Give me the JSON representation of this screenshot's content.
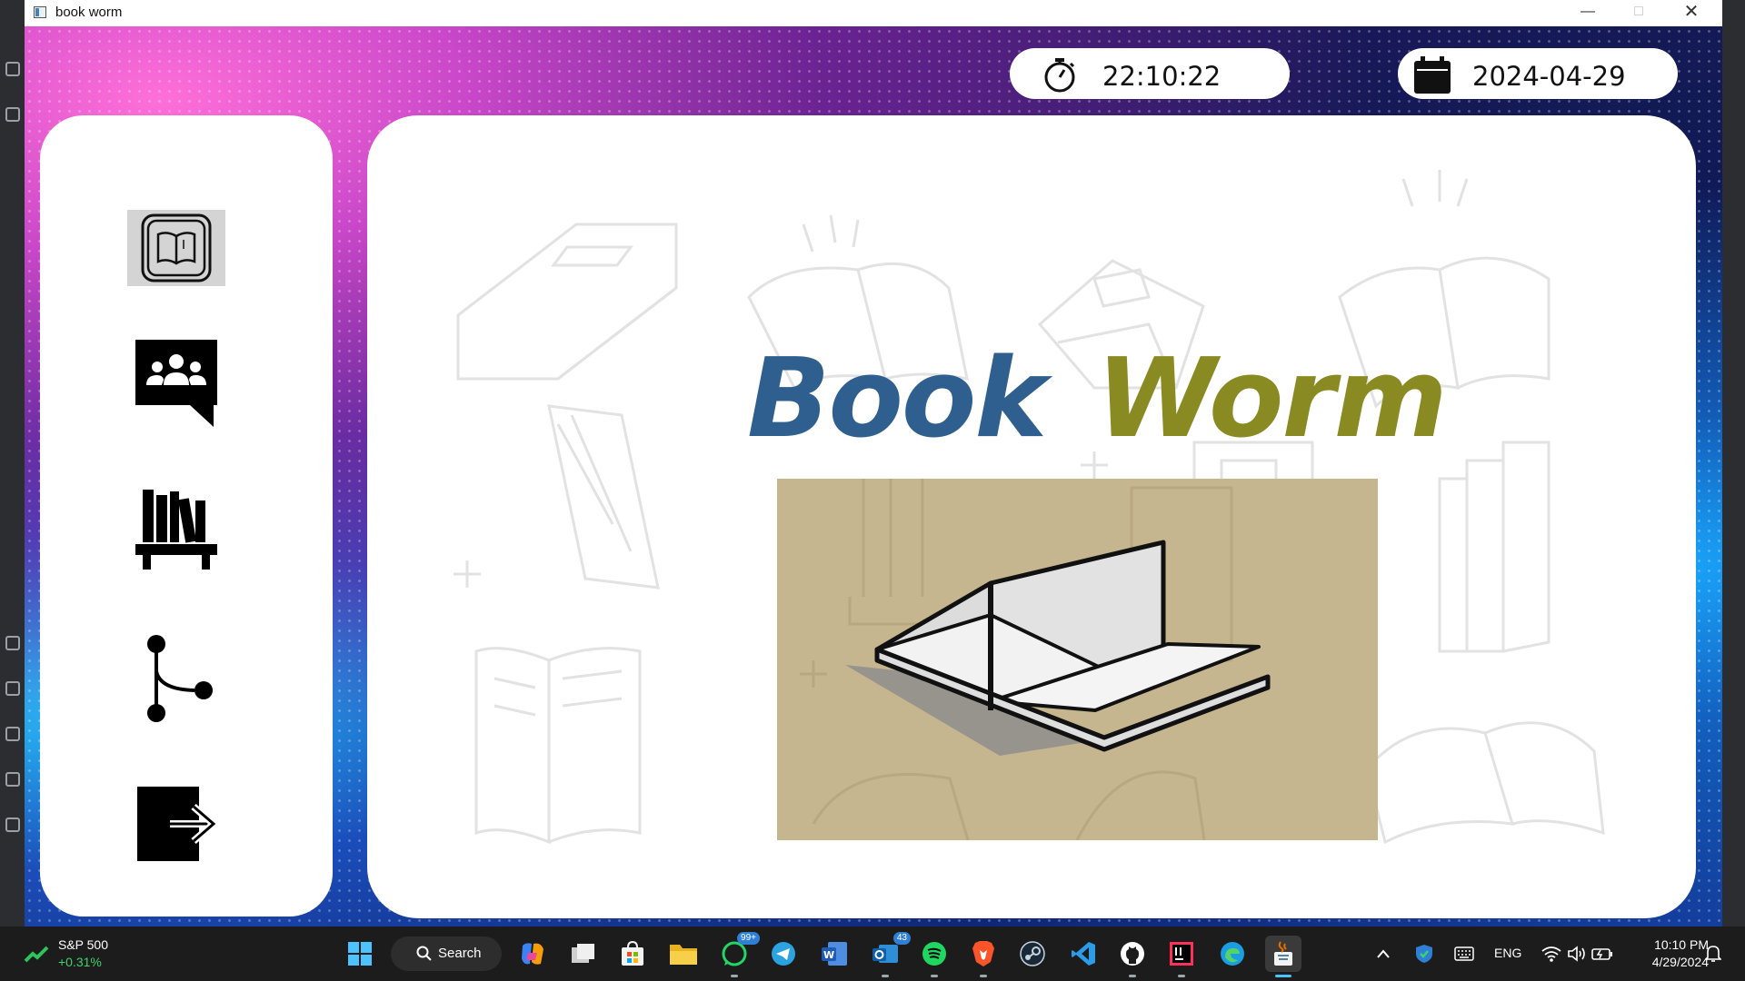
{
  "window": {
    "title": "book worm"
  },
  "clock": {
    "time": "22:10:22"
  },
  "calendar": {
    "date": "2024-04-29"
  },
  "sidebar": {
    "items": [
      {
        "name": "books",
        "icon": "open-book-icon",
        "active": true
      },
      {
        "name": "community",
        "icon": "group-chat-icon",
        "active": false
      },
      {
        "name": "library",
        "icon": "bookshelf-icon",
        "active": false
      },
      {
        "name": "branches",
        "icon": "branch-icon",
        "active": false
      },
      {
        "name": "logout",
        "icon": "logout-icon",
        "active": false
      }
    ]
  },
  "main": {
    "title_word1": "Book",
    "title_word2": "Worm"
  },
  "colors": {
    "title_blue": "#2e5f8f",
    "title_olive": "#8a8a22",
    "hero_bg": "#c6b68f"
  },
  "taskbar": {
    "stock": {
      "name": "S&P 500",
      "change": "+0.31%"
    },
    "search_label": "Search",
    "whatsapp_badge": "99+",
    "outlook_badge": "43",
    "language": "ENG",
    "time": "10:10 PM",
    "date": "4/29/2024"
  }
}
